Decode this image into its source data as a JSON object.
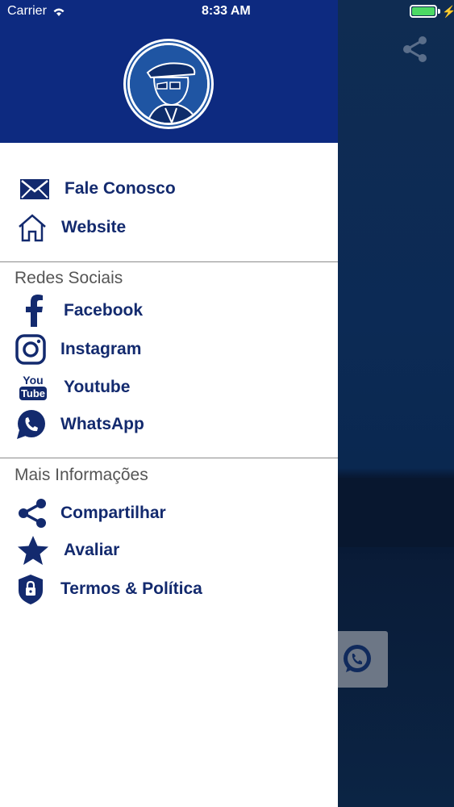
{
  "status_bar": {
    "carrier": "Carrier",
    "time": "8:33 AM"
  },
  "colors": {
    "primary": "#0d2a80",
    "text_primary": "#132a6e",
    "section_text": "#555555"
  },
  "drawer": {
    "top_items": [
      {
        "label": "Fale Conosco",
        "icon": "envelope-icon"
      },
      {
        "label": "Website",
        "icon": "home-icon"
      }
    ],
    "social_section": {
      "title": "Redes Sociais",
      "items": [
        {
          "label": "Facebook",
          "icon": "facebook-icon"
        },
        {
          "label": "Instagram",
          "icon": "instagram-icon"
        },
        {
          "label": "Youtube",
          "icon": "youtube-icon"
        },
        {
          "label": "WhatsApp",
          "icon": "whatsapp-icon"
        }
      ]
    },
    "info_section": {
      "title": "Mais Informações",
      "items": [
        {
          "label": "Compartilhar",
          "icon": "share-icon"
        },
        {
          "label": "Avaliar",
          "icon": "star-icon"
        },
        {
          "label": "Termos & Política",
          "icon": "shield-lock-icon"
        }
      ]
    },
    "youtube_icon_text": {
      "top": "You",
      "bottom": "Tube"
    }
  }
}
